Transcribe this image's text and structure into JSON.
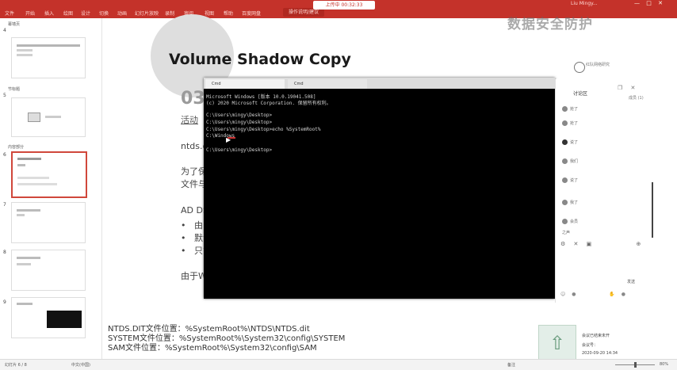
{
  "window": {
    "title": "2020...",
    "account": "Liu Mingy...",
    "rec_badge": "上传中 00:32:33",
    "share_button": "操作说明/建议"
  },
  "ribbon": {
    "items": [
      "文件",
      "开始",
      "插入",
      "绘图",
      "设计",
      "切换",
      "动画",
      "幻灯片放映",
      "录制",
      "审阅",
      "视图",
      "帮助",
      "百度网盘"
    ]
  },
  "watermark": "数据安全防护",
  "thumbnails": {
    "sections": [
      "幕墙页",
      "节标题",
      "内容部分"
    ],
    "slide_numbers": [
      "4",
      "5",
      "6",
      "7",
      "8",
      "9"
    ]
  },
  "slide": {
    "title": "Volume Shadow Copy",
    "section_number": "03",
    "section_subtitle": "活动",
    "logo_text": "红队网络研究",
    "body": {
      "ntds_partial": "ntds.d",
      "purpose_partial_1": "为了保",
      "purpose_partial_2": "文件与",
      "ad_partial": "AD DS",
      "bullets": [
        "由",
        "默认",
        "只能"
      ],
      "footer_partial": "由于W"
    },
    "file_locations": [
      "NTDS.DIT文件位置：%SystemRoot%\\NTDS\\NTDS.dit",
      "SYSTEM文件位置：%SystemRoot%\\System32\\config\\SYSTEM",
      "SAM文件位置：%SystemRoot%\\System32\\config\\SAM"
    ]
  },
  "terminal": {
    "tabs": [
      "Cmd",
      "Cmd"
    ],
    "lines": [
      "Microsoft Windows [版本 10.0.19041.508]",
      "(c) 2020 Microsoft Corporation. 保留所有权利。",
      "",
      "C:\\Users\\mingy\\Desktop>",
      "C:\\Users\\mingy\\Desktop>",
      "C:\\Users\\mingy\\Desktop>echo %SystemRoot%",
      "C:\\Windows",
      "",
      "C:\\Users\\mingy\\Desktop>"
    ]
  },
  "chat": {
    "header": "讨论区",
    "more": "成员 (1)",
    "items": [
      "抢了",
      "抢了",
      "说了",
      "我们",
      "说了",
      "我了",
      "会员",
      "之声"
    ],
    "send_label": "发送"
  },
  "overlay": {
    "up_icon": "arrow-up-icon",
    "info_lines": [
      "会议已结束未开",
      "会议号：",
      "2020-09-20 14:34"
    ]
  },
  "status": {
    "slide_info": "幻灯片 6 / 8",
    "lang": "中文(中国)",
    "notes": "备注",
    "zoom": "80%"
  }
}
